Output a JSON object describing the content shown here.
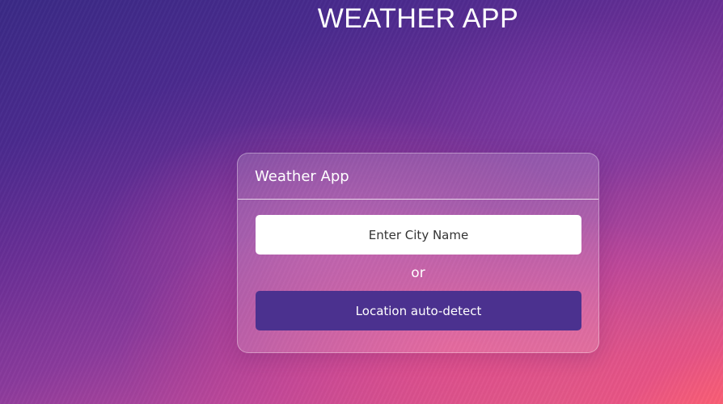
{
  "header": {
    "title": "WEATHER APP"
  },
  "card": {
    "title": "Weather App",
    "city_input": {
      "placeholder": "Enter City Name",
      "value": ""
    },
    "separator_text": "or",
    "detect_button_label": "Location auto-detect"
  },
  "colors": {
    "button_bg": "#4b318f",
    "text": "#ffffff",
    "input_bg": "#ffffff"
  }
}
